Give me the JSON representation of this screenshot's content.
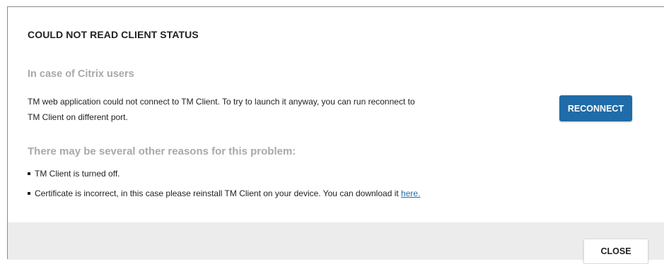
{
  "dialog": {
    "title": "COULD NOT READ CLIENT STATUS",
    "citrix_heading": "In case of Citrix users",
    "citrix_paragraph_line1": "TM web application could not connect to TM Client. To try to launch it anyway, you can run reconnect to",
    "citrix_paragraph_line2": "TM Client on different port.",
    "reconnect_label": "RECONNECT",
    "reasons_heading": "There may be several other reasons for this problem:",
    "reasons": [
      {
        "text": "TM Client is turned off."
      },
      {
        "text": "Certificate is incorrect, in this case please reinstall TM Client on your device. You can download it ",
        "link_text": "here."
      }
    ],
    "close_label": "CLOSE"
  },
  "colors": {
    "accent": "#1f6ca8",
    "heading_gray": "#a9a9a9",
    "footer_bg": "#ececec"
  }
}
